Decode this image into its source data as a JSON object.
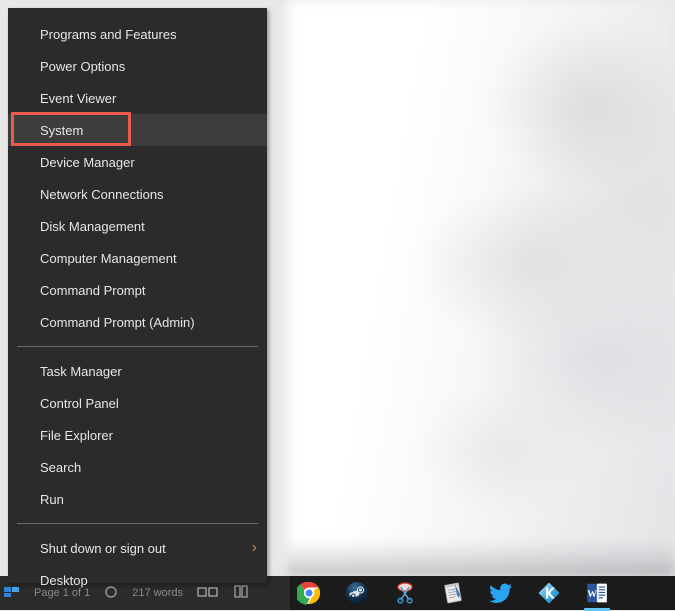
{
  "window": {
    "backdrop_label": "Blurred document window behind menu",
    "document_app": "Microsoft Word document (blurred)"
  },
  "context_menu": {
    "name": "Windows X / Power User menu",
    "background_color": "#2b2b2b",
    "highlight_color": "#3d3d3d",
    "text_color": "#e6e6e6",
    "groups": [
      {
        "items": [
          {
            "label": "Programs and Features",
            "highlighted": false,
            "submenu": false
          },
          {
            "label": "Power Options",
            "highlighted": false,
            "submenu": false
          },
          {
            "label": "Event Viewer",
            "highlighted": false,
            "submenu": false
          },
          {
            "label": "System",
            "highlighted": true,
            "submenu": false
          },
          {
            "label": "Device Manager",
            "highlighted": false,
            "submenu": false
          },
          {
            "label": "Network Connections",
            "highlighted": false,
            "submenu": false
          },
          {
            "label": "Disk Management",
            "highlighted": false,
            "submenu": false
          },
          {
            "label": "Computer Management",
            "highlighted": false,
            "submenu": false
          },
          {
            "label": "Command Prompt",
            "highlighted": false,
            "submenu": false
          },
          {
            "label": "Command Prompt (Admin)",
            "highlighted": false,
            "submenu": false
          }
        ]
      },
      {
        "items": [
          {
            "label": "Task Manager",
            "highlighted": false,
            "submenu": false
          },
          {
            "label": "Control Panel",
            "highlighted": false,
            "submenu": false
          },
          {
            "label": "File Explorer",
            "highlighted": false,
            "submenu": false
          },
          {
            "label": "Search",
            "highlighted": false,
            "submenu": false
          },
          {
            "label": "Run",
            "highlighted": false,
            "submenu": false
          }
        ]
      },
      {
        "items": [
          {
            "label": "Shut down or sign out",
            "highlighted": false,
            "submenu": true,
            "chevron": "›"
          },
          {
            "label": "Desktop",
            "highlighted": false,
            "submenu": false
          }
        ]
      }
    ]
  },
  "annotation": {
    "type": "rectangle-highlight",
    "target_label": "System",
    "color": "#ea5b4b",
    "border_width_px": 3
  },
  "word_status_bar": {
    "page_text": "Page 1 of 1",
    "word_count_text": "217 words"
  },
  "taskbar": {
    "background_color": "#1b1b1b",
    "active_indicator_color": "#62c4f2",
    "icons": [
      {
        "name": "chrome-icon",
        "label": "Google Chrome",
        "active": true
      },
      {
        "name": "steam-icon",
        "label": "Steam",
        "active": false
      },
      {
        "name": "snipping-tool-icon",
        "label": "Snipping Tool",
        "active": false
      },
      {
        "name": "notepad-icon",
        "label": "Notepad",
        "active": false
      },
      {
        "name": "twitter-icon",
        "label": "Twitter",
        "active": false
      },
      {
        "name": "kodi-icon",
        "label": "Kodi",
        "active": false
      },
      {
        "name": "word-icon",
        "label": "Microsoft Word",
        "active": true
      }
    ]
  }
}
